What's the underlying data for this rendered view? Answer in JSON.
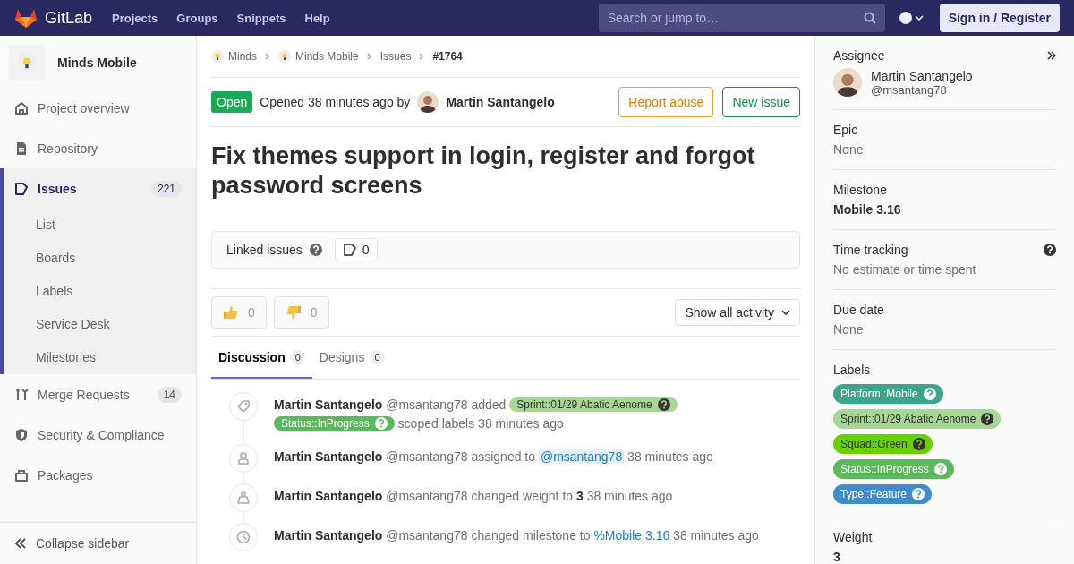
{
  "navbar": {
    "brand": "GitLab",
    "links": [
      "Projects",
      "Groups",
      "Snippets",
      "Help"
    ],
    "search": {
      "placeholder": "Search or jump to…"
    },
    "sign_in": "Sign in / Register"
  },
  "sidebar": {
    "project": "Minds Mobile",
    "items": [
      {
        "label": "Project overview",
        "kind": "home",
        "selected": false
      },
      {
        "label": "Repository",
        "kind": "doc",
        "selected": false
      },
      {
        "label": "Issues",
        "kind": "issues",
        "count": "221",
        "selected": true,
        "children": [
          {
            "label": "List"
          },
          {
            "label": "Boards"
          },
          {
            "label": "Labels"
          },
          {
            "label": "Service Desk"
          },
          {
            "label": "Milestones"
          }
        ]
      },
      {
        "label": "Merge Requests",
        "kind": "merge",
        "count": "14",
        "selected": false
      },
      {
        "label": "Security & Compliance",
        "kind": "shield",
        "selected": false
      },
      {
        "label": "Packages",
        "kind": "package",
        "selected": false
      }
    ],
    "collapse": "Collapse sidebar"
  },
  "breadcrumbs": [
    {
      "label": "Minds",
      "kind": "project"
    },
    {
      "label": "Minds Mobile",
      "kind": "project"
    },
    {
      "label": "Issues",
      "kind": "link"
    },
    {
      "label": "#1764",
      "kind": "current"
    }
  ],
  "issue": {
    "status": "Open",
    "opened": "Opened 38 minutes ago by",
    "author": "Martin Santangelo",
    "buttons": [
      {
        "label": "Report abuse",
        "kind": "warning"
      },
      {
        "label": "New issue",
        "kind": "success"
      }
    ],
    "title": "Fix themes support in login, register and forgot password screens",
    "linked": {
      "label": "Linked issues",
      "count": "0"
    },
    "reactions": [
      {
        "kind": "thumbsup",
        "count": "0"
      },
      {
        "kind": "thumbsdown",
        "count": "0"
      }
    ],
    "activity_filter": "Show all activity",
    "tabs": [
      {
        "label": "Discussion",
        "count": "0",
        "selected": true
      },
      {
        "label": "Designs",
        "count": "0",
        "selected": false
      }
    ]
  },
  "activity": [
    {
      "kind": "labels",
      "author": "Martin Santangelo",
      "username": "@msantang78",
      "parts": [
        {
          "kind": "text",
          "text": "added"
        },
        {
          "kind": "label",
          "text": "Sprint::01/29 Abatic Aenome",
          "color": "#a8d695"
        },
        {
          "kind": "label",
          "text": "Status::InProgress",
          "color": "#5cb85c"
        },
        {
          "kind": "text",
          "text": "scoped labels 38 minutes ago"
        }
      ]
    },
    {
      "kind": "assignee",
      "author": "Martin Santangelo",
      "username": "@msantang78",
      "parts": [
        {
          "kind": "text",
          "text": "assigned to"
        },
        {
          "kind": "mention",
          "text": "@msantang78"
        },
        {
          "kind": "text",
          "text": "38 minutes ago"
        }
      ]
    },
    {
      "kind": "weight",
      "author": "Martin Santangelo",
      "username": "@msantang78",
      "parts": [
        {
          "kind": "text",
          "text": "changed weight to"
        },
        {
          "kind": "bold",
          "text": "3"
        },
        {
          "kind": "text",
          "text": "38 minutes ago"
        }
      ]
    },
    {
      "kind": "milestone",
      "author": "Martin Santangelo",
      "username": "@msantang78",
      "parts": [
        {
          "kind": "text",
          "text": "changed milestone to"
        },
        {
          "kind": "link",
          "text": "%Mobile 3.16"
        },
        {
          "kind": "text",
          "text": "38 minutes ago"
        }
      ]
    }
  ],
  "right_sidebar": [
    {
      "kind": "assignee",
      "title": "Assignee",
      "name": "Martin Santangelo",
      "username": "@msantang78"
    },
    {
      "kind": "plain",
      "title": "Epic",
      "value": "None"
    },
    {
      "kind": "bold",
      "title": "Milestone",
      "value": "Mobile 3.16"
    },
    {
      "kind": "help",
      "title": "Time tracking",
      "value": "No estimate or time spent"
    },
    {
      "kind": "plain",
      "title": "Due date",
      "value": "None"
    },
    {
      "kind": "labels",
      "title": "Labels",
      "labels": [
        {
          "text": "Platform::Mobile",
          "color": "#3da58a"
        },
        {
          "text": "Sprint::01/29 Abatic Aenome",
          "color": "#a8d695"
        },
        {
          "text": "Squad::Green",
          "color": "#69d100"
        },
        {
          "text": "Status::InProgress",
          "color": "#5cb85c"
        },
        {
          "text": "Type::Feature",
          "color": "#428bca"
        }
      ]
    },
    {
      "kind": "bold",
      "title": "Weight",
      "value": "3"
    }
  ]
}
